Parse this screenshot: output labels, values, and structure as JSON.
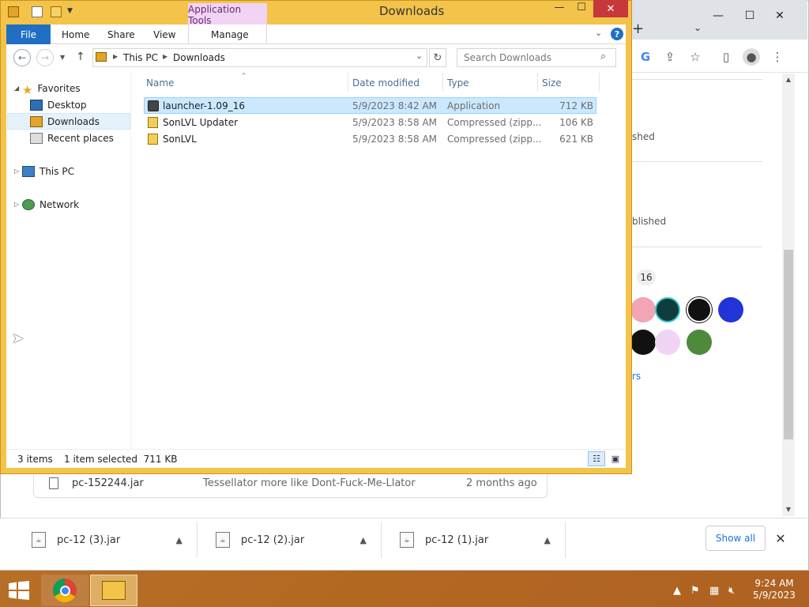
{
  "explorer": {
    "title": "Downloads",
    "context_tab": "Application Tools",
    "ribbon_tabs": [
      "File",
      "Home",
      "Share",
      "View",
      "Manage"
    ],
    "address": [
      "This PC",
      "Downloads"
    ],
    "search_placeholder": "Search Downloads",
    "nav": {
      "favorites": "Favorites",
      "desktop": "Desktop",
      "downloads": "Downloads",
      "recent": "Recent places",
      "this_pc": "This PC",
      "network": "Network"
    },
    "columns": [
      "Name",
      "Date modified",
      "Type",
      "Size"
    ],
    "files": [
      {
        "name": "launcher-1.09_16",
        "date": "5/9/2023 8:42 AM",
        "type": "Application",
        "size": "712 KB",
        "selected": true
      },
      {
        "name": "SonLVL Updater",
        "date": "5/9/2023 8:58 AM",
        "type": "Compressed (zipp...",
        "size": "106 KB",
        "selected": false
      },
      {
        "name": "SonLVL",
        "date": "5/9/2023 8:58 AM",
        "type": "Compressed (zipp...",
        "size": "621 KB",
        "selected": false
      }
    ],
    "status": {
      "count": "3 items",
      "selection": "1 item selected  711 KB"
    }
  },
  "chrome": {
    "text_published_1": "shed",
    "text_published_2": "blished",
    "count_badge": "16",
    "link_partial": "rs",
    "file_row": {
      "name": "pc-152244.jar",
      "message": "Tessellator more like Dont-Fuck-Me-Llator",
      "age": "2 months ago"
    },
    "downloads": [
      "pc-12 (3).jar",
      "pc-12 (2).jar",
      "pc-12 (1).jar"
    ],
    "show_all": "Show all"
  },
  "taskbar": {
    "time": "9:24 AM",
    "date": "5/9/2023"
  },
  "colors": {
    "accent": "#1f6fc4",
    "selection": "#cce8ff",
    "folder": "#f3c34a",
    "link": "#1a73e8"
  }
}
